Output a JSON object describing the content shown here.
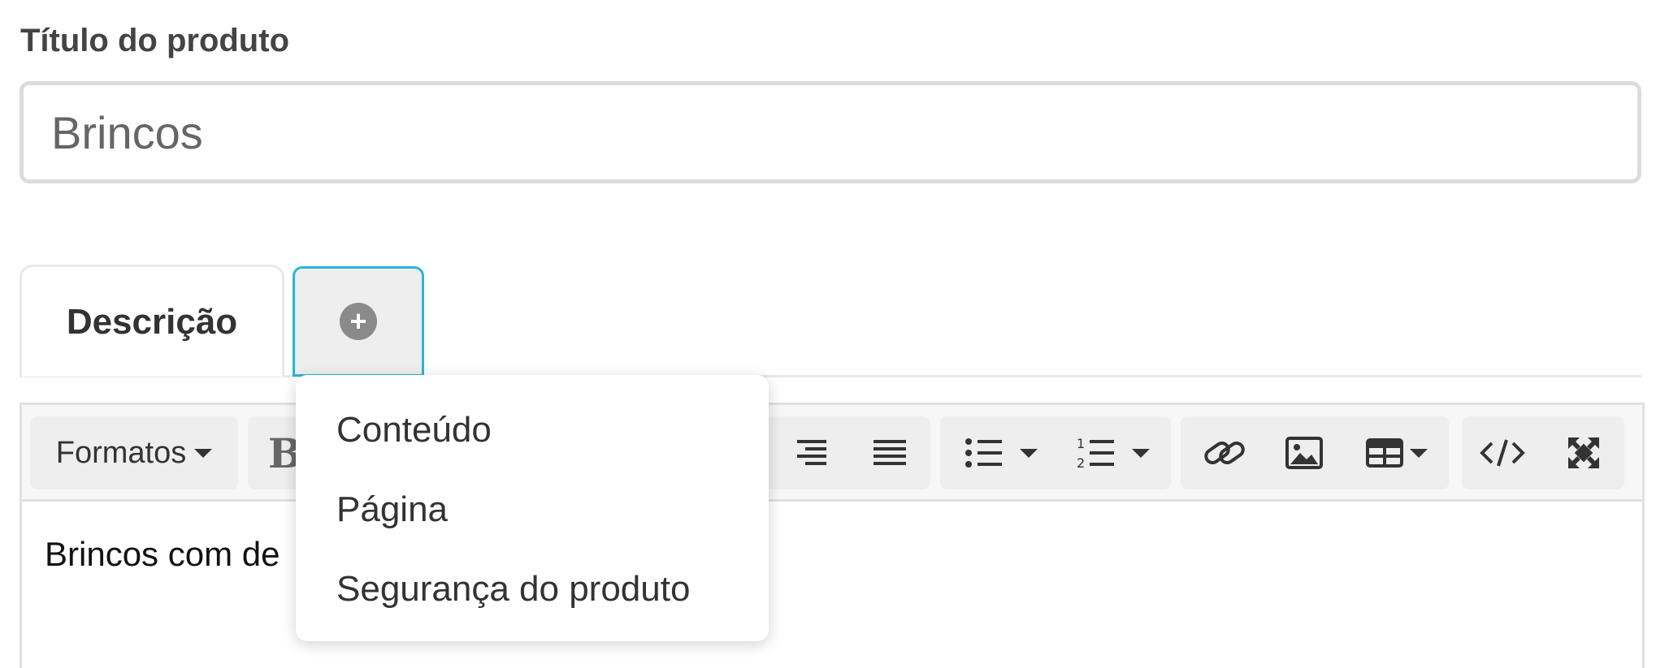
{
  "field": {
    "label": "Título do produto",
    "value": "Brincos"
  },
  "tabs": [
    {
      "label": "Descrição",
      "active": true
    },
    {
      "icon": "plus-circle-icon"
    }
  ],
  "dropdown": {
    "items": [
      "Conteúdo",
      "Página",
      "Segurança do produto"
    ]
  },
  "toolbar": {
    "formats_label": "Formatos",
    "bold_glyph": "B",
    "buttons": [
      "align-right-icon",
      "align-justify-icon",
      "bullet-list-icon",
      "numbered-list-icon",
      "link-icon",
      "image-icon",
      "table-icon",
      "code-icon",
      "fullscreen-icon"
    ]
  },
  "editor": {
    "content": "Brincos com de"
  },
  "colors": {
    "tab_focus_border": "#29b6d6",
    "input_border": "#dcdcdc",
    "toolbar_bg": "#f7f7f7"
  }
}
